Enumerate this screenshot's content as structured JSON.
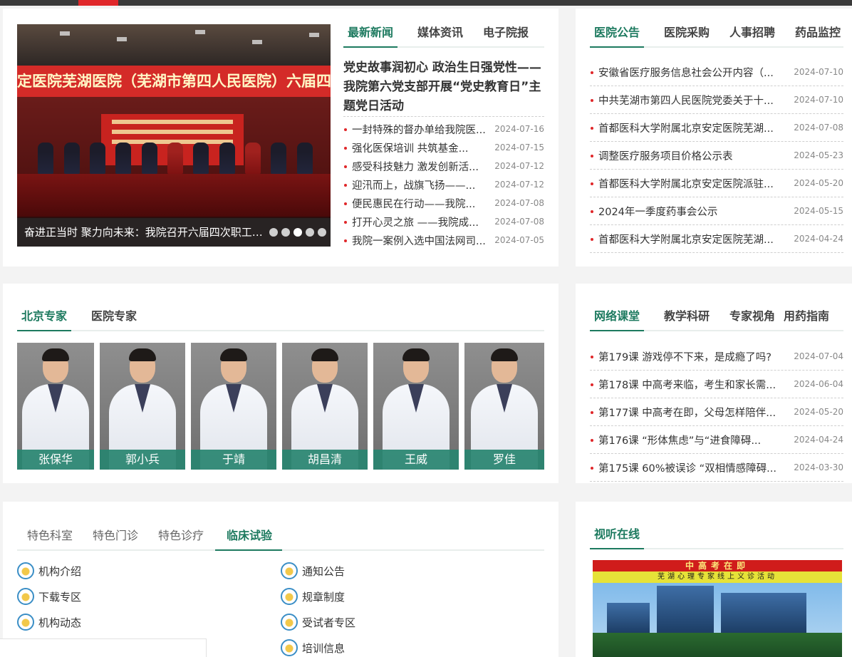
{
  "colors": {
    "accent": "#1d7a5f",
    "bullet": "#e0272a",
    "expert_bar": "#288470"
  },
  "news": {
    "tabs": [
      "最新新闻",
      "媒体资讯",
      "电子院报"
    ],
    "slide_banner": "定医院芜湖医院（芜湖市第四人民医院）六届四次职工代表暨会",
    "slide_backdrop": "首都医科大学附属北京安定医院芜湖医院",
    "slide_caption": "奋进正当时 聚力向未来：我院召开六届四次职工代表大会",
    "slide_dots": 5,
    "slide_active": 2,
    "headline": "党史故事润初心 政治生日强党性——我院第六党支部开展“党史教育日”主题党日活动",
    "items": [
      {
        "title": "一封特殊的督办单给我院医...",
        "date": "2024-07-16"
      },
      {
        "title": "强化医保培训 共筑基金...",
        "date": "2024-07-15"
      },
      {
        "title": "感受科技魅力 激发创新活...",
        "date": "2024-07-12"
      },
      {
        "title": "迎汛而上，战旗飞扬——...",
        "date": "2024-07-12"
      },
      {
        "title": "便民惠民在行动——我院...",
        "date": "2024-07-08"
      },
      {
        "title": "打开心灵之旅 ——我院成...",
        "date": "2024-07-08"
      },
      {
        "title": "我院一案例入选中国法网司...",
        "date": "2024-07-05"
      }
    ]
  },
  "notice": {
    "tabs": [
      "医院公告",
      "医院采购",
      "人事招聘",
      "药品监控"
    ],
    "items": [
      {
        "title": "安徽省医疗服务信息社会公开内容（...",
        "date": "2024-07-10"
      },
      {
        "title": "中共芜湖市第四人民医院党委关于十...",
        "date": "2024-07-10"
      },
      {
        "title": "首都医科大学附属北京安定医院芜湖...",
        "date": "2024-07-08"
      },
      {
        "title": "调整医疗服务项目价格公示表",
        "date": "2024-05-23"
      },
      {
        "title": "首都医科大学附属北京安定医院派驻...",
        "date": "2024-05-20"
      },
      {
        "title": "2024年一季度药事会公示",
        "date": "2024-05-15"
      },
      {
        "title": "首都医科大学附属北京安定医院芜湖...",
        "date": "2024-04-24"
      }
    ]
  },
  "experts": {
    "tabs": [
      "北京专家",
      "医院专家"
    ],
    "people": [
      "张保华",
      "郭小兵",
      "于靖",
      "胡昌清",
      "王威",
      "罗佳"
    ]
  },
  "classroom": {
    "tabs": [
      "网络课堂",
      "教学科研",
      "专家视角",
      "用药指南"
    ],
    "items": [
      {
        "title": "第179课 游戏停不下来，是成瘾了吗?",
        "date": "2024-07-04"
      },
      {
        "title": "第178课 中高考来临，考生和家长需...",
        "date": "2024-06-04"
      },
      {
        "title": "第177课 中高考在即，父母怎样陪伴...",
        "date": "2024-05-20"
      },
      {
        "title": "第176课 “形体焦虑”与“进食障碍...",
        "date": "2024-04-24"
      },
      {
        "title": "第175课 60%被误诊 “双相情感障碍...",
        "date": "2024-03-30"
      }
    ]
  },
  "features": {
    "tabs": [
      "特色科室",
      "特色门诊",
      "特色诊疗",
      "临床试验"
    ],
    "links": [
      "机构介绍",
      "通知公告",
      "下载专区",
      "规章制度",
      "机构动态",
      "受试者专区",
      "",
      "培训信息"
    ]
  },
  "video": {
    "tab": "视听在线",
    "title": "中高考在即",
    "subtitle": "芜湖心理专家线上义诊活动"
  }
}
